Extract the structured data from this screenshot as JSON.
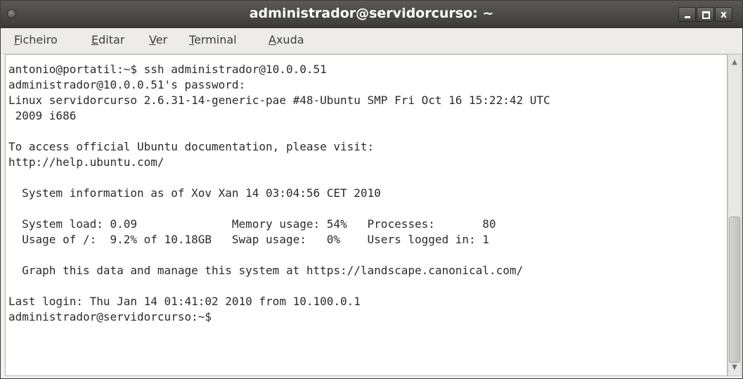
{
  "window": {
    "title": "administrador@servidorcurso: ~",
    "buttons": {
      "minimize": "_",
      "maximize": "□",
      "close": "x"
    }
  },
  "menubar": {
    "items": [
      {
        "label": "Ficheiro",
        "accel": "F",
        "rest": "icheiro"
      },
      {
        "label": "Editar",
        "accel": "E",
        "rest": "ditar"
      },
      {
        "label": "Ver",
        "accel": "V",
        "rest": "er"
      },
      {
        "label": "Terminal",
        "accel": "T",
        "rest": "erminal"
      },
      {
        "label": "Axuda",
        "accel": "A",
        "rest": "xuda"
      }
    ]
  },
  "terminal": {
    "lines": [
      "antonio@portatil:~$ ssh administrador@10.0.0.51",
      "administrador@10.0.0.51's password:",
      "Linux servidorcurso 2.6.31-14-generic-pae #48-Ubuntu SMP Fri Oct 16 15:22:42 UTC",
      " 2009 i686",
      "",
      "To access official Ubuntu documentation, please visit:",
      "http://help.ubuntu.com/",
      "",
      "  System information as of Xov Xan 14 03:04:56 CET 2010",
      "",
      "  System load: 0.09              Memory usage: 54%   Processes:       80",
      "  Usage of /:  9.2% of 10.18GB   Swap usage:   0%    Users logged in: 1",
      "",
      "  Graph this data and manage this system at https://landscape.canonical.com/",
      "",
      "Last login: Thu Jan 14 01:41:02 2010 from 10.100.0.1",
      "administrador@servidorcurso:~$"
    ]
  },
  "scrollbar": {
    "up_icon": "chevron-up-icon",
    "down_icon": "chevron-down-icon"
  },
  "colors": {
    "titlebar": "#3c3b37",
    "menubar": "#edeceb",
    "terminal_bg": "#ffffff",
    "terminal_fg": "#2b2b2b"
  }
}
